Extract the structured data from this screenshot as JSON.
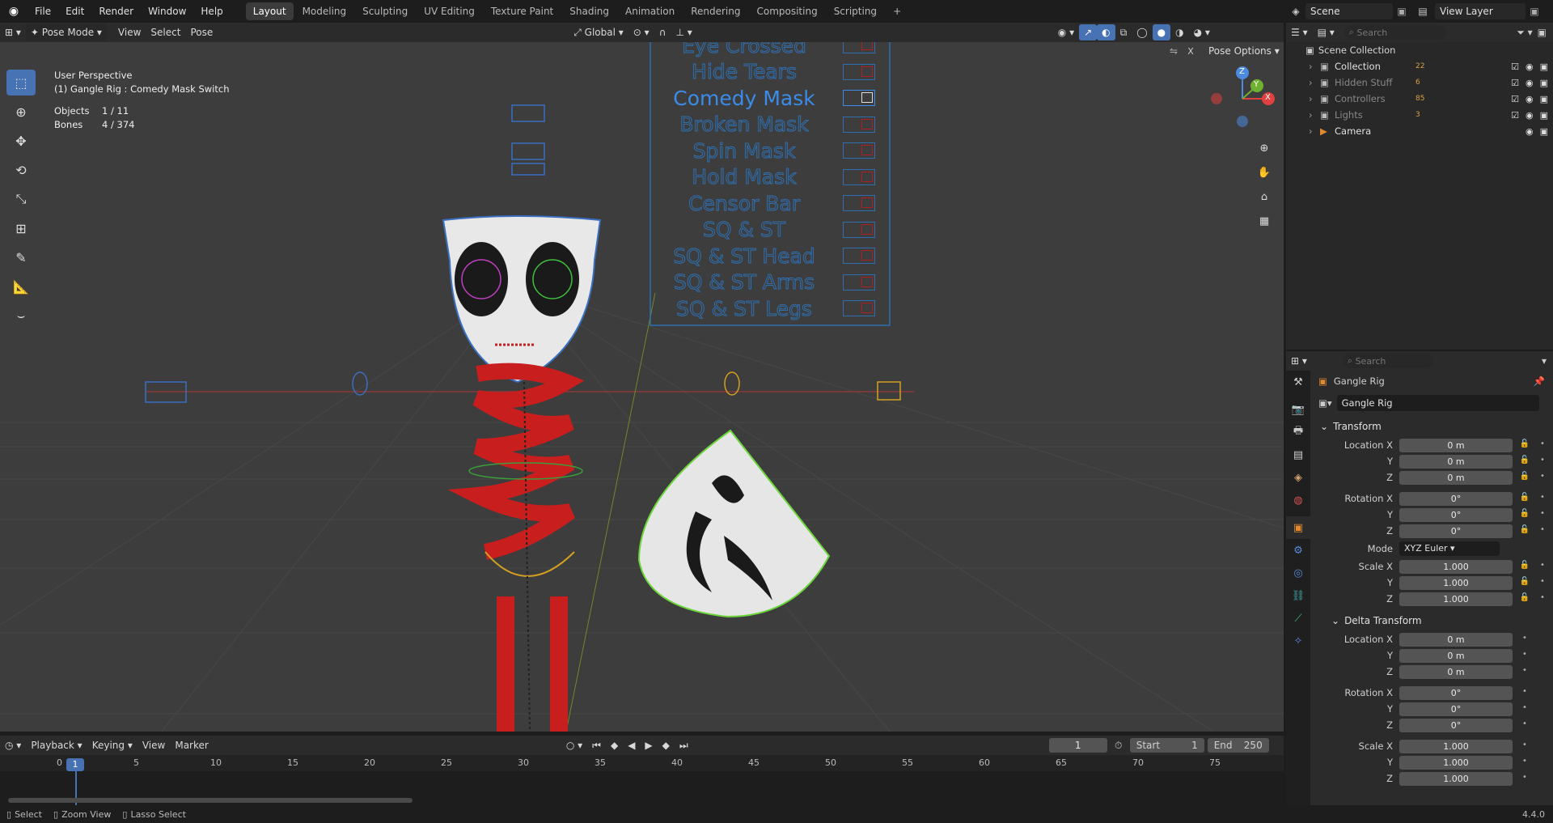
{
  "menubar": {
    "items": [
      "File",
      "Edit",
      "Render",
      "Window",
      "Help"
    ],
    "workspaces": [
      "Layout",
      "Modeling",
      "Sculpting",
      "UV Editing",
      "Texture Paint",
      "Shading",
      "Animation",
      "Rendering",
      "Compositing",
      "Scripting"
    ],
    "add": "+",
    "scene": "Scene",
    "view_layer": "View Layer"
  },
  "viewport_header": {
    "mode": "Pose Mode",
    "menus": [
      "View",
      "Select",
      "Pose"
    ],
    "orientation": "Global",
    "pose_options": "Pose Options"
  },
  "overlay": {
    "perspective": "User Perspective",
    "context": "(1) Gangle Rig : Comedy Mask Switch",
    "objects_label": "Objects",
    "objects_value": "1 / 11",
    "bones_label": "Bones",
    "bones_value": "4 / 374"
  },
  "rig_panel": {
    "items": [
      "Eye Crossed",
      "Hide Tears",
      "Comedy Mask",
      "Broken Mask",
      "Spin Mask",
      "Hold Mask",
      "Censor Bar",
      "SQ & ST",
      "SQ & ST Head",
      "SQ & ST Arms",
      "SQ & ST Legs"
    ]
  },
  "gizmo": {
    "z": "Z",
    "y": "Y",
    "x": "X"
  },
  "timeline": {
    "menus": [
      "Playback",
      "Keying",
      "View",
      "Marker"
    ],
    "current": "1",
    "start_label": "Start",
    "start": "1",
    "end_label": "End",
    "end": "250",
    "ticks": [
      "0",
      "5",
      "10",
      "15",
      "20",
      "25",
      "30",
      "35",
      "40",
      "45",
      "50",
      "55",
      "60",
      "65",
      "70",
      "75"
    ],
    "playhead": "1"
  },
  "statusbar": {
    "items": [
      "Select",
      "Zoom View",
      "Lasso Select"
    ],
    "version": "4.4.0"
  },
  "outliner": {
    "search_placeholder": "Search",
    "root": "Scene Collection",
    "rows": [
      {
        "name": "Collection",
        "count": "22"
      },
      {
        "name": "Hidden Stuff",
        "count": "6"
      },
      {
        "name": "Controllers",
        "count": "85"
      },
      {
        "name": "Lights",
        "count": "3"
      },
      {
        "name": "Camera",
        "count": ""
      }
    ]
  },
  "properties": {
    "search_placeholder": "Search",
    "object_name": "Gangle Rig",
    "data_name": "Gangle Rig",
    "transform_label": "Transform",
    "location_x_label": "Location X",
    "loc": [
      "0 m",
      "0 m",
      "0 m"
    ],
    "rotation_x_label": "Rotation X",
    "rot": [
      "0°",
      "0°",
      "0°"
    ],
    "mode_label": "Mode",
    "mode": "XYZ Euler",
    "scale_x_label": "Scale X",
    "scale": [
      "1.000",
      "1.000",
      "1.000"
    ],
    "y_label": "Y",
    "z_label": "Z",
    "delta_label": "Delta Transform",
    "dloc": [
      "0 m",
      "0 m",
      "0 m"
    ],
    "drot": [
      "0°",
      "0°",
      "0°"
    ],
    "dscale": [
      "1.000",
      "1.000",
      "1.000"
    ]
  }
}
